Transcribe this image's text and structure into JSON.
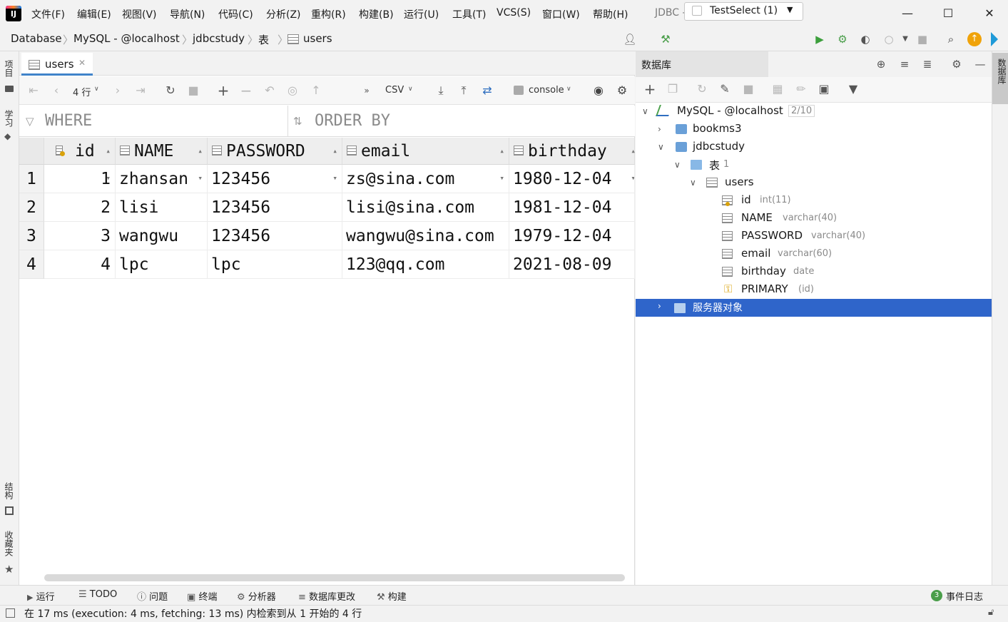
{
  "menu": [
    "文件(F)",
    "编辑(E)",
    "视图(V)",
    "导航(N)",
    "代码(C)",
    "分析(Z)",
    "重构(R)",
    "构建(B)",
    "运行(U)",
    "工具(T)",
    "VCS(S)",
    "窗口(W)",
    "帮助(H)"
  ],
  "window_title": "JDBC - users",
  "breadcrumb": [
    "Database",
    "MySQL - @localhost",
    "jdbcstudy",
    "表",
    "users"
  ],
  "run_config": "TestSelect (1)",
  "left_tabs": [
    "项目",
    "学习",
    "结构",
    "收藏夹"
  ],
  "right_tab": "数据库",
  "editor_tab": "users",
  "data_toolbar": {
    "row_count": "4 行",
    "format": "CSV",
    "session": "console"
  },
  "filters": {
    "where": "WHERE",
    "order_by": "ORDER BY"
  },
  "table": {
    "columns": [
      "id",
      "NAME",
      "PASSWORD",
      "email",
      "birthday"
    ],
    "row_numbers": [
      "1",
      "2",
      "3",
      "4"
    ],
    "rows": [
      [
        "1",
        "zhansan",
        "123456",
        "zs@sina.com",
        "1980-12-04"
      ],
      [
        "2",
        "lisi",
        "123456",
        "lisi@sina.com",
        "1981-12-04"
      ],
      [
        "3",
        "wangwu",
        "123456",
        "wangwu@sina.com",
        "1979-12-04"
      ],
      [
        "4",
        "lpc",
        "lpc",
        "123@qq.com",
        "2021-08-09"
      ]
    ]
  },
  "db_panel": {
    "title": "数据库",
    "connection": "MySQL - @localhost",
    "connection_count": "2/10",
    "schemas": [
      "bookms3",
      "jdbcstudy"
    ],
    "tables_folder": "表",
    "tables_count": "1",
    "table_name": "users",
    "columns": [
      {
        "name": "id",
        "type": "int(11)"
      },
      {
        "name": "NAME",
        "type": "varchar(40)"
      },
      {
        "name": "PASSWORD",
        "type": "varchar(40)"
      },
      {
        "name": "email",
        "type": "varchar(60)"
      },
      {
        "name": "birthday",
        "type": "date"
      },
      {
        "name": "PRIMARY",
        "type": "(id)"
      }
    ],
    "server_objects": "服务器对象"
  },
  "bottom_tabs": [
    "运行",
    "TODO",
    "问题",
    "终端",
    "分析器",
    "数据库更改",
    "构建"
  ],
  "event_log": {
    "count": "3",
    "label": "事件日志"
  },
  "status": "在 17 ms (execution: 4 ms, fetching: 13 ms) 内检索到从 1 开始的 4 行",
  "colors": {
    "accent": "#4083c9",
    "selection": "#2f65ca",
    "run_green": "#3c9f3c"
  }
}
